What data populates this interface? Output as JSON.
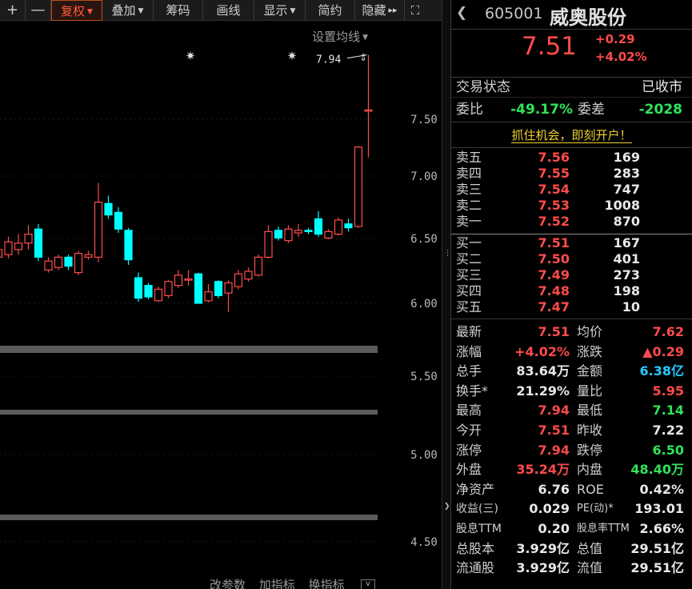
{
  "toolbar": {
    "plus": "+",
    "minus": "—",
    "items": [
      {
        "label": "复权",
        "caret": "▼",
        "active": true
      },
      {
        "label": "叠加",
        "caret": "▼"
      },
      {
        "label": "筹码"
      },
      {
        "label": "画线"
      },
      {
        "label": "显示",
        "caret": "▼"
      },
      {
        "label": "简约"
      },
      {
        "label": "隐藏",
        "caret": "▸▸"
      }
    ],
    "fullscreen": "⛶"
  },
  "chart": {
    "ma_setting_label": "设置均线",
    "ma_setting_caret": "▼",
    "high_marker_label": "7.94",
    "marker_glyph": "✷",
    "price_axis_labels": [
      "7.50",
      "7.00",
      "6.50",
      "6.00",
      "5.50",
      "5.00",
      "4.50"
    ],
    "bottom_buttons": [
      "改参数",
      "加指标",
      "换指标"
    ],
    "collapse_glyph": "v",
    "up_color": "#ff4b4b",
    "down_color": "#00ffff",
    "candles": [
      {
        "o": 6.36,
        "c": 6.42,
        "h": 6.46,
        "l": 6.32
      },
      {
        "o": 6.38,
        "c": 6.48,
        "h": 6.52,
        "l": 6.35
      },
      {
        "o": 6.42,
        "c": 6.47,
        "h": 6.54,
        "l": 6.38
      },
      {
        "o": 6.47,
        "c": 6.54,
        "h": 6.61,
        "l": 6.42
      },
      {
        "o": 6.58,
        "c": 6.36,
        "h": 6.62,
        "l": 6.33
      },
      {
        "o": 6.26,
        "c": 6.33,
        "h": 6.36,
        "l": 6.24
      },
      {
        "o": 6.28,
        "c": 6.36,
        "h": 6.38,
        "l": 6.26
      },
      {
        "o": 6.36,
        "c": 6.29,
        "h": 6.38,
        "l": 6.26
      },
      {
        "o": 6.24,
        "c": 6.39,
        "h": 6.41,
        "l": 6.22
      },
      {
        "o": 6.36,
        "c": 6.38,
        "h": 6.41,
        "l": 6.34
      },
      {
        "o": 6.36,
        "c": 6.79,
        "h": 6.94,
        "l": 6.32
      },
      {
        "o": 6.78,
        "c": 6.69,
        "h": 6.84,
        "l": 6.66
      },
      {
        "o": 6.71,
        "c": 6.58,
        "h": 6.75,
        "l": 6.55
      },
      {
        "o": 6.57,
        "c": 6.34,
        "h": 6.59,
        "l": 6.3
      },
      {
        "o": 6.2,
        "c": 6.04,
        "h": 6.24,
        "l": 6.01
      },
      {
        "o": 6.14,
        "c": 6.05,
        "h": 6.16,
        "l": 5.99
      },
      {
        "o": 6.02,
        "c": 6.11,
        "h": 6.13,
        "l": 6.01
      },
      {
        "o": 6.06,
        "c": 6.17,
        "h": 6.18,
        "l": 6.04
      },
      {
        "o": 6.14,
        "c": 6.22,
        "h": 6.26,
        "l": 6.12
      },
      {
        "o": 6.19,
        "c": 6.19,
        "h": 6.26,
        "l": 6.14
      },
      {
        "o": 6.23,
        "c": 6.0,
        "h": 6.24,
        "l": 5.98
      },
      {
        "o": 6.02,
        "c": 6.09,
        "h": 6.15,
        "l": 5.97
      },
      {
        "o": 6.17,
        "c": 6.06,
        "h": 6.18,
        "l": 6.04
      },
      {
        "o": 6.08,
        "c": 6.16,
        "h": 6.18,
        "l": 5.91
      },
      {
        "o": 6.13,
        "c": 6.23,
        "h": 6.26,
        "l": 6.11
      },
      {
        "o": 6.19,
        "c": 6.25,
        "h": 6.28,
        "l": 6.17
      },
      {
        "o": 6.22,
        "c": 6.36,
        "h": 6.38,
        "l": 6.21
      },
      {
        "o": 6.36,
        "c": 6.56,
        "h": 6.61,
        "l": 6.35
      },
      {
        "o": 6.57,
        "c": 6.51,
        "h": 6.6,
        "l": 6.49
      },
      {
        "o": 6.49,
        "c": 6.58,
        "h": 6.61,
        "l": 6.47
      },
      {
        "o": 6.55,
        "c": 6.57,
        "h": 6.62,
        "l": 6.52
      },
      {
        "o": 6.57,
        "c": 6.56,
        "h": 6.59,
        "l": 6.54
      },
      {
        "o": 6.66,
        "c": 6.54,
        "h": 6.72,
        "l": 6.52
      },
      {
        "o": 6.51,
        "c": 6.56,
        "h": 6.58,
        "l": 6.5
      },
      {
        "o": 6.54,
        "c": 6.65,
        "h": 6.67,
        "l": 6.53
      },
      {
        "o": 6.62,
        "c": 6.59,
        "h": 6.66,
        "l": 6.56
      },
      {
        "o": 6.6,
        "c": 7.22,
        "h": 7.23,
        "l": 6.59
      },
      {
        "o": 7.51,
        "c": 7.51,
        "h": 7.94,
        "l": 7.14
      }
    ]
  },
  "quote": {
    "nav_arrow": "❮",
    "code": "605001",
    "name": "威奥股份",
    "price": "7.51",
    "change": "+0.29",
    "change_pct": "+4.02%",
    "status_label": "交易状态",
    "status_value": "已收市",
    "weibi_label": "委比",
    "weibi_value": "-49.17%",
    "weicha_label": "委差",
    "weicha_value": "-2028",
    "promo": "抓住机会，即刻开户！",
    "asks": [
      {
        "label": "卖五",
        "price": "7.56",
        "vol": "169"
      },
      {
        "label": "卖四",
        "price": "7.55",
        "vol": "283"
      },
      {
        "label": "卖三",
        "price": "7.54",
        "vol": "747"
      },
      {
        "label": "卖二",
        "price": "7.53",
        "vol": "1008"
      },
      {
        "label": "卖一",
        "price": "7.52",
        "vol": "870"
      }
    ],
    "bids": [
      {
        "label": "买一",
        "price": "7.51",
        "vol": "167"
      },
      {
        "label": "买二",
        "price": "7.50",
        "vol": "401"
      },
      {
        "label": "买三",
        "price": "7.49",
        "vol": "273"
      },
      {
        "label": "买四",
        "price": "7.48",
        "vol": "198"
      },
      {
        "label": "买五",
        "price": "7.47",
        "vol": "10"
      }
    ],
    "stats": [
      {
        "l1": "最新",
        "v1": "7.51",
        "c1": "red",
        "l2": "均价",
        "v2": "7.62",
        "c2": "red"
      },
      {
        "l1": "涨幅",
        "v1": "+4.02%",
        "c1": "red",
        "l2": "涨跌",
        "v2": "▲0.29",
        "c2": "red"
      },
      {
        "l1": "总手",
        "v1": "83.64万",
        "c1": "white",
        "l2": "金额",
        "v2": "6.38亿",
        "c2": "cyan"
      },
      {
        "l1": "换手*",
        "v1": "21.29%",
        "c1": "white",
        "l2": "量比",
        "v2": "5.95",
        "c2": "red"
      },
      {
        "l1": "最高",
        "v1": "7.94",
        "c1": "red",
        "l2": "最低",
        "v2": "7.14",
        "c2": "green"
      },
      {
        "l1": "今开",
        "v1": "7.51",
        "c1": "red",
        "l2": "昨收",
        "v2": "7.22",
        "c2": "white"
      },
      {
        "l1": "涨停",
        "v1": "7.94",
        "c1": "red",
        "l2": "跌停",
        "v2": "6.50",
        "c2": "green"
      },
      {
        "l1": "外盘",
        "v1": "35.24万",
        "c1": "red",
        "l2": "内盘",
        "v2": "48.40万",
        "c2": "green"
      },
      {
        "l1": "净资产",
        "v1": "6.76",
        "c1": "white",
        "l2": "ROE",
        "v2": "0.42%",
        "c2": "white"
      },
      {
        "l1": "收益(三)",
        "v1": "0.029",
        "c1": "white",
        "l2": "PE(动)*",
        "v2": "193.01",
        "c2": "white"
      },
      {
        "l1": "股息TTM",
        "v1": "0.20",
        "c1": "white",
        "l2": "股息率TTM",
        "v2": "2.66%",
        "c2": "white"
      },
      {
        "l1": "总股本",
        "v1": "3.929亿",
        "c1": "white",
        "l2": "总值",
        "v2": "29.51亿",
        "c2": "white"
      },
      {
        "l1": "流通股",
        "v1": "3.929亿",
        "c1": "white",
        "l2": "流值",
        "v2": "29.51亿",
        "c2": "white"
      }
    ]
  }
}
